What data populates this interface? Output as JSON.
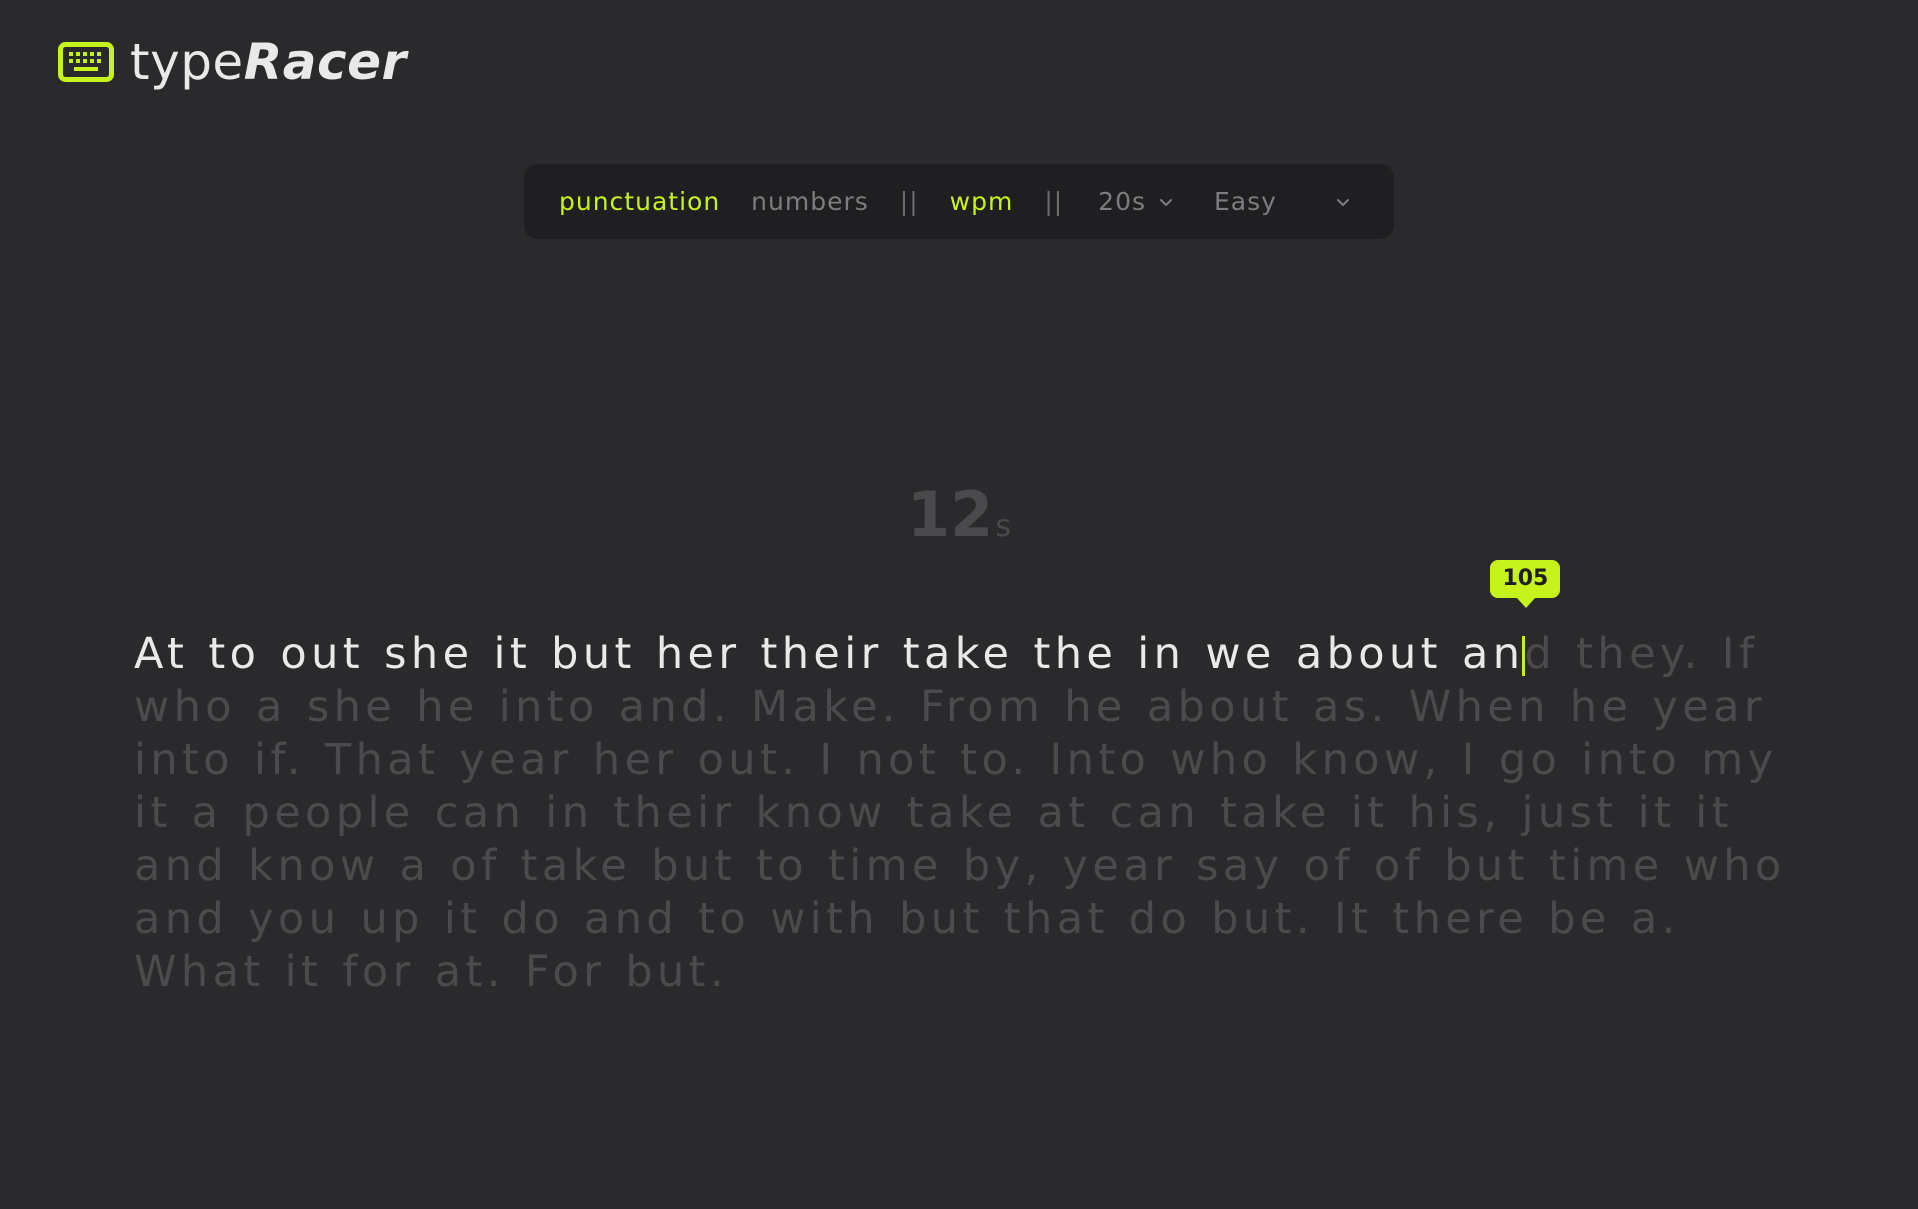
{
  "app": {
    "logo_icon": "keyboard-icon",
    "title_light": "type",
    "title_bold": "Racer"
  },
  "toolbar": {
    "punctuation": "punctuation",
    "numbers": "numbers",
    "separator": "||",
    "wpm": "wpm",
    "duration": "20s",
    "difficulty": "Easy",
    "active_color": "#c6f31b"
  },
  "timer": {
    "value": "12",
    "unit": "s"
  },
  "typing": {
    "typed": "At to out she it but her their take the in we about an",
    "remaining": "d they. If who a she he into and. Make. From he about as. When he year into if. That year her out. I not to. Into who know, I go into my it a people can in their know take at can take it his, just it it and know a of take but to time by, year say of of but time who and you up it do and to with but that do but. It there be a. What it for at. For but.",
    "live_wpm": "105"
  }
}
